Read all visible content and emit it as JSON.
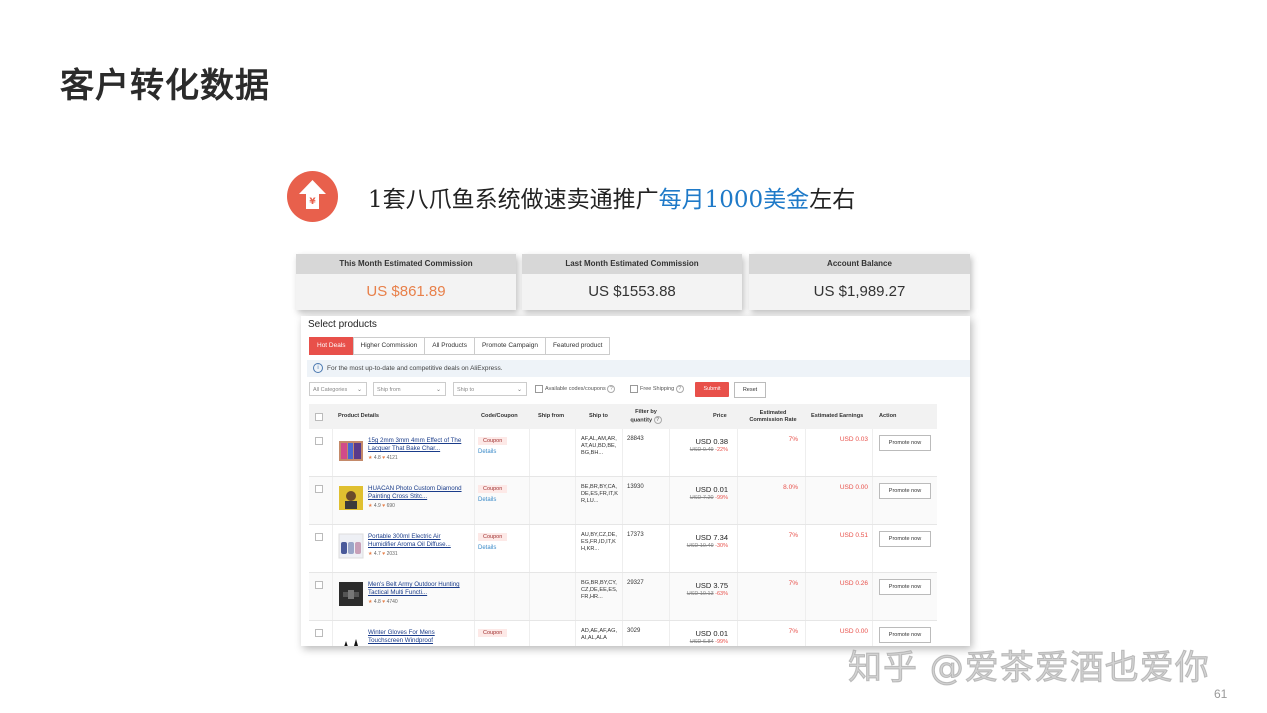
{
  "slide": {
    "title": "客户转化数据",
    "headline_prefix": "1套八爪鱼系统做速卖通推广",
    "headline_highlight": "每月1000美金",
    "headline_suffix": "左右",
    "page_number": "61",
    "watermark": "知乎 @爱茶爱酒也爱你"
  },
  "stats": [
    {
      "label": "This Month Estimated Commission",
      "value": "US $861.89"
    },
    {
      "label": "Last Month Estimated Commission",
      "value": "US $1553.88"
    },
    {
      "label": "Account Balance",
      "value": "US $1,989.27"
    }
  ],
  "panel": {
    "title": "Select products",
    "tabs": [
      "Hot Deals",
      "Higher Commission",
      "All Products",
      "Promote Campaign",
      "Featured product"
    ],
    "active_tab": "Hot Deals",
    "info": "For the most up-to-date and competitive deals on AliExpress.",
    "filters": {
      "category": "All Categories",
      "ship_from": "Ship from",
      "ship_to": "Ship to",
      "available_codes": "Available codes/coupons",
      "free_shipping": "Free Shipping",
      "submit": "Submit",
      "reset": "Reset"
    },
    "columns": {
      "product": "Product Details",
      "code": "Code/Coupon",
      "ship_from": "Ship from",
      "ship_to": "Ship to",
      "filter_qty": "Filter by quantity",
      "price": "Price",
      "rate": "Estimated Commission Rate",
      "earnings": "Estimated Earnings",
      "action": "Action"
    },
    "rows": [
      {
        "name": "15g 2mm 3mm 4mm Effect of The Lacquer That Bake Char...",
        "rating": "4.8",
        "reviews": "4121",
        "coupon": "Coupon",
        "details": "Details",
        "ship_to": "AF,AL,AM,AR,AT,AU,BD,BE,BG,BH...",
        "qty": "28843",
        "price": "USD 0.38",
        "old_price": "USD 0.49",
        "discount": "-22%",
        "rate": "7%",
        "earnings": "USD 0.03",
        "action": "Promote now"
      },
      {
        "name": "HUACAN Photo Custom Diamond Painting Cross Stitc...",
        "rating": "4.9",
        "reviews": "690",
        "coupon": "Coupon",
        "details": "Details",
        "ship_to": "BE,BR,BY,CA,DE,ES,FR,IT,KR,LU...",
        "qty": "13930",
        "price": "USD 0.01",
        "old_price": "USD 7.20",
        "discount": "-99%",
        "rate": "8.0%",
        "earnings": "USD 0.00",
        "action": "Promote now"
      },
      {
        "name": "Portable 300ml Electric Air Humidifier Aroma Oil Diffuse...",
        "rating": "4.7",
        "reviews": "2031",
        "coupon": "Coupon",
        "details": "Details",
        "ship_to": "AU,BY,CZ,DE,ES,FR,ID,IT,KH,KR...",
        "qty": "17373",
        "price": "USD 7.34",
        "old_price": "USD 10.49",
        "discount": "-30%",
        "rate": "7%",
        "earnings": "USD 0.51",
        "action": "Promote now"
      },
      {
        "name": "Men's Belt Army Outdoor Hunting Tactical Multi Functi...",
        "rating": "4.8",
        "reviews": "4740",
        "coupon": "",
        "details": "",
        "ship_to": "BG,BR,BY,CY,CZ,DE,EE,ES,FR,HR...",
        "qty": "29327",
        "price": "USD 3.75",
        "old_price": "USD 10.13",
        "discount": "-63%",
        "rate": "7%",
        "earnings": "USD 0.26",
        "action": "Promote now"
      },
      {
        "name": "Winter Gloves For Mens Touchscreen Windproof",
        "rating": "",
        "reviews": "",
        "coupon": "Coupon",
        "details": "",
        "ship_to": "AD,AE,AF,AG,AI,AL,ALA",
        "qty": "3029",
        "price": "USD 0.01",
        "old_price": "USD 6.84",
        "discount": "-99%",
        "rate": "7%",
        "earnings": "USD 0.00",
        "action": "Promote now"
      }
    ]
  },
  "colors": {
    "accent": "#e8504a",
    "highlight": "#1f7ac8",
    "commission_orange": "#e8804a"
  }
}
